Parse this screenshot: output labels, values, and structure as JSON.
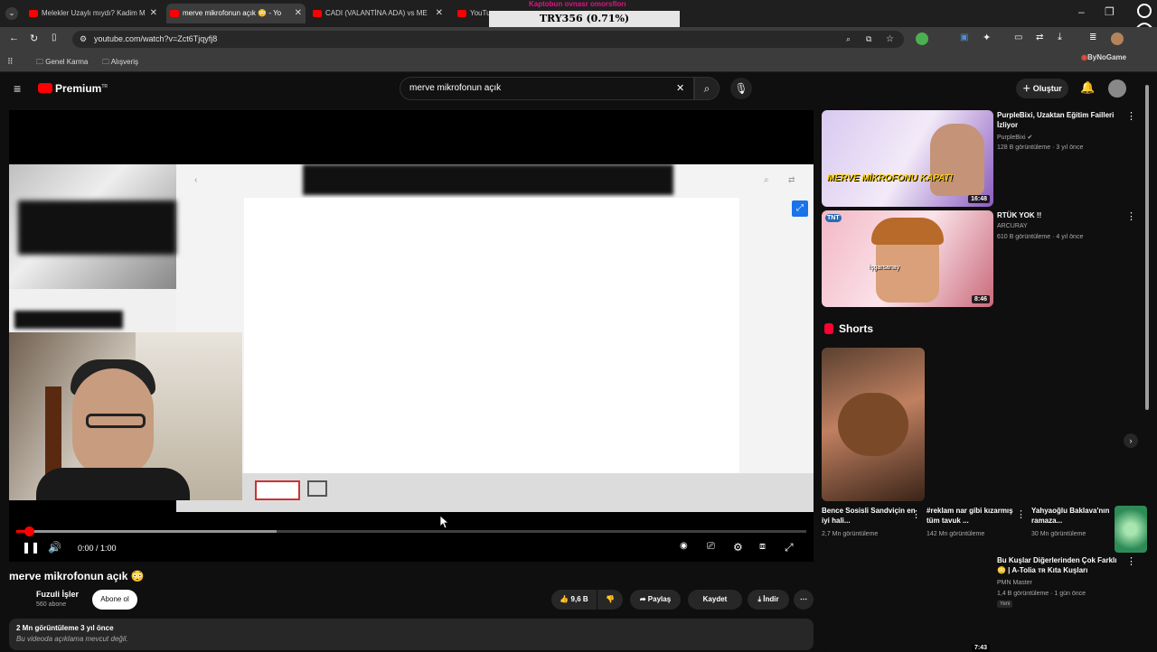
{
  "browser": {
    "tabs": [
      {
        "title": "Melekler Uzaylı mıydı? Kadim M"
      },
      {
        "title": "merve mikrofonun açık 😳 - Yo"
      },
      {
        "title": "CADI (VALANTİNA ADA) vs ME"
      },
      {
        "title": "YouTube"
      }
    ],
    "overlay_top": "Kaptobun ovnasr omorsflorı",
    "overlay_ticker": "TRY356 (0.71%)",
    "url": "youtube.com/watch?v=Zct6Tjqyfj8",
    "bookmarks": [
      "Genel Karma",
      "Alışveriş"
    ],
    "extension_label": "ByNoGame"
  },
  "youtube": {
    "logo": "Premium",
    "logo_sup": "TR",
    "search_value": "merve mikrofonun açık",
    "create_label": "Oluştur"
  },
  "player": {
    "time": "0:00 / 1:00",
    "progress_played": 0.005,
    "progress_loaded": 0.33
  },
  "video": {
    "title": "merve mikrofonun açık 😳",
    "channel": "Fuzuli İşler",
    "subscribers": "560 abone",
    "subscribe_label": "Abone ol",
    "likes": "9,6 B",
    "share_label": "Paylaş",
    "save_label": "Kaydet",
    "download_label": "İndir",
    "views_date": "2 Mn görüntüleme  3 yıl önce",
    "description": "Bu videoda açıklama mevcut değil."
  },
  "recommendations": [
    {
      "title": "PurpleBixi, Uzaktan Eğitim Failleri İzliyor",
      "channel": "PurpleBixi",
      "meta": "128 B görüntüleme · 3 yıl önce",
      "duration": "16:48",
      "thumb_text": "MERVE MİKROFONU KAPAT!"
    },
    {
      "title": "RTÜK YOK !!",
      "channel": "ARCURAY",
      "meta": "610 B görüntüleme · 4 yıl önce",
      "duration": "8:46",
      "thumb_text": "İşgarsanay"
    }
  ],
  "shorts": {
    "heading": "Shorts",
    "items": [
      {
        "title": "Bence Sosisli Sandviçin en iyi hali...",
        "views": "2,7 Mn görüntüleme"
      },
      {
        "title": "#reklam nar gibi kızarmış tüm tavuk ...",
        "views": "142 Mn görüntüleme"
      },
      {
        "title": "Yahyaoğlu Baklava'nın ramaza...",
        "views": "30 Mn görüntüleme"
      }
    ]
  },
  "rec_third": {
    "title": "Bu Kuşlar Diğerlerinden Çok Farklı 😳 | A-Tolia ᴛʀ Kıta Kuşları",
    "channel": "PMN Master",
    "meta": "1,4 B görüntüleme · 1 gün önce",
    "badge": "Yeni",
    "duration": "7:43"
  }
}
